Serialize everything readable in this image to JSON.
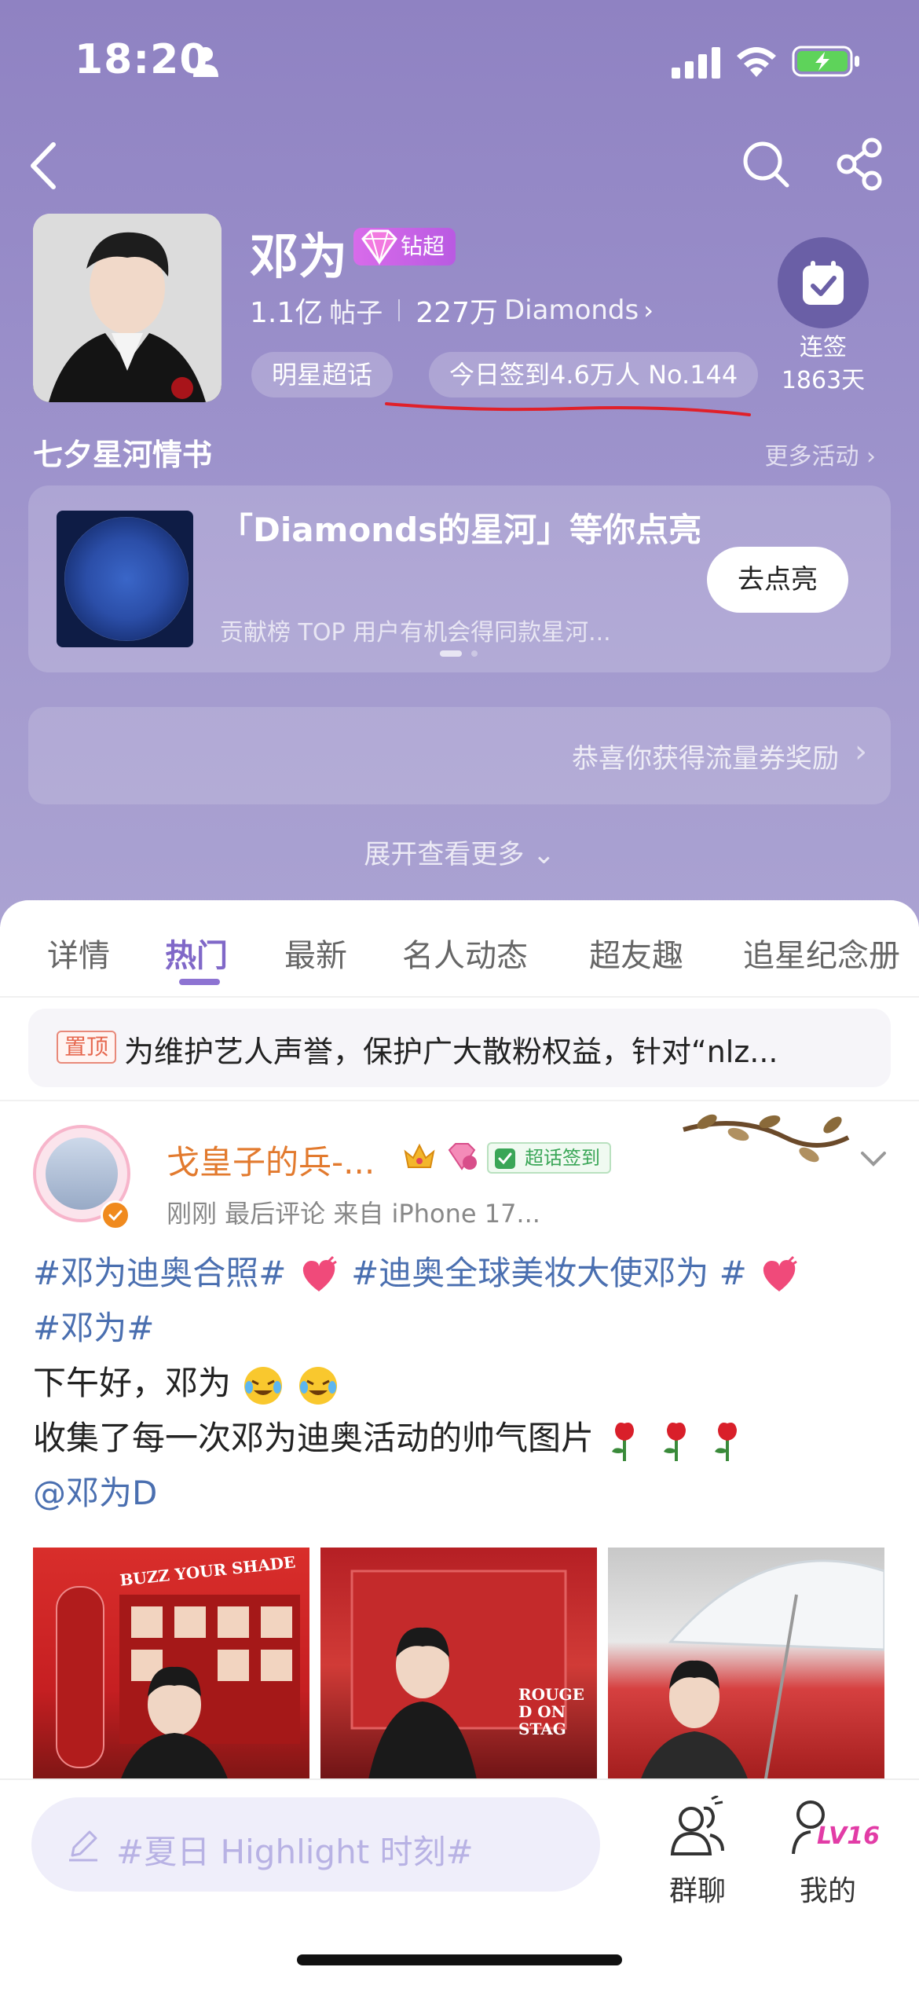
{
  "status_bar": {
    "time": "18:20"
  },
  "header": {
    "topic_name": "邓为",
    "badge_label": "钻超",
    "posts_count": "1.1亿",
    "posts_label": "帖子",
    "fans_count": "227万",
    "fans_label": "Diamonds",
    "category_chip": "明星超话",
    "checkin_chip": "今日签到4.6万人 No.144",
    "streak_label": "连签",
    "streak_days": "1863天"
  },
  "event": {
    "section_title": "七夕星河情书",
    "more_label": "更多活动",
    "headline": "「Diamonds的星河」等你点亮",
    "subtitle": "贡献榜 TOP 用户有机会得同款星河...",
    "button_label": "去点亮"
  },
  "reward": {
    "text": "恭喜你获得流量券奖励"
  },
  "expand_label": "展开查看更多",
  "tabs": [
    {
      "label": "详情"
    },
    {
      "label": "热门"
    },
    {
      "label": "最新"
    },
    {
      "label": "名人动态"
    },
    {
      "label": "超友趣"
    },
    {
      "label": "追星纪念册"
    }
  ],
  "active_tab": "热门",
  "pinned": {
    "tag": "置顶",
    "text": "为维护艺人声誉，保护广大散粉权益，针对“nlz..."
  },
  "post": {
    "username": "戈皇子的兵-...",
    "checkin_tag": "超话签到",
    "meta": "刚刚  最后评论  来自 iPhone 17...",
    "hashtag_1": "#邓为迪奥合照#",
    "hashtag_2": "#迪奥全球美妆大使邓为 #",
    "hashtag_3": "#邓为#",
    "line_1": "下午好，邓为",
    "line_2": "收集了每一次邓为迪奥活动的帅气图片",
    "mention": "@邓为D",
    "photo_1_text": "BUZZ YOUR SHADE",
    "photo_2_text": "ROUGE D ON STAG"
  },
  "bottom_bar": {
    "compose_placeholder": "#夏日 Highlight 时刻#",
    "group_chat_label": "群聊",
    "mine_label": "我的",
    "level_badge": "LV16"
  },
  "colors": {
    "hero_bg": "#9a8fca",
    "active_tab": "#8068c8",
    "username": "#e27a2e",
    "hashtag": "#4a6fb0",
    "diamond_badge": "#c862e6"
  }
}
